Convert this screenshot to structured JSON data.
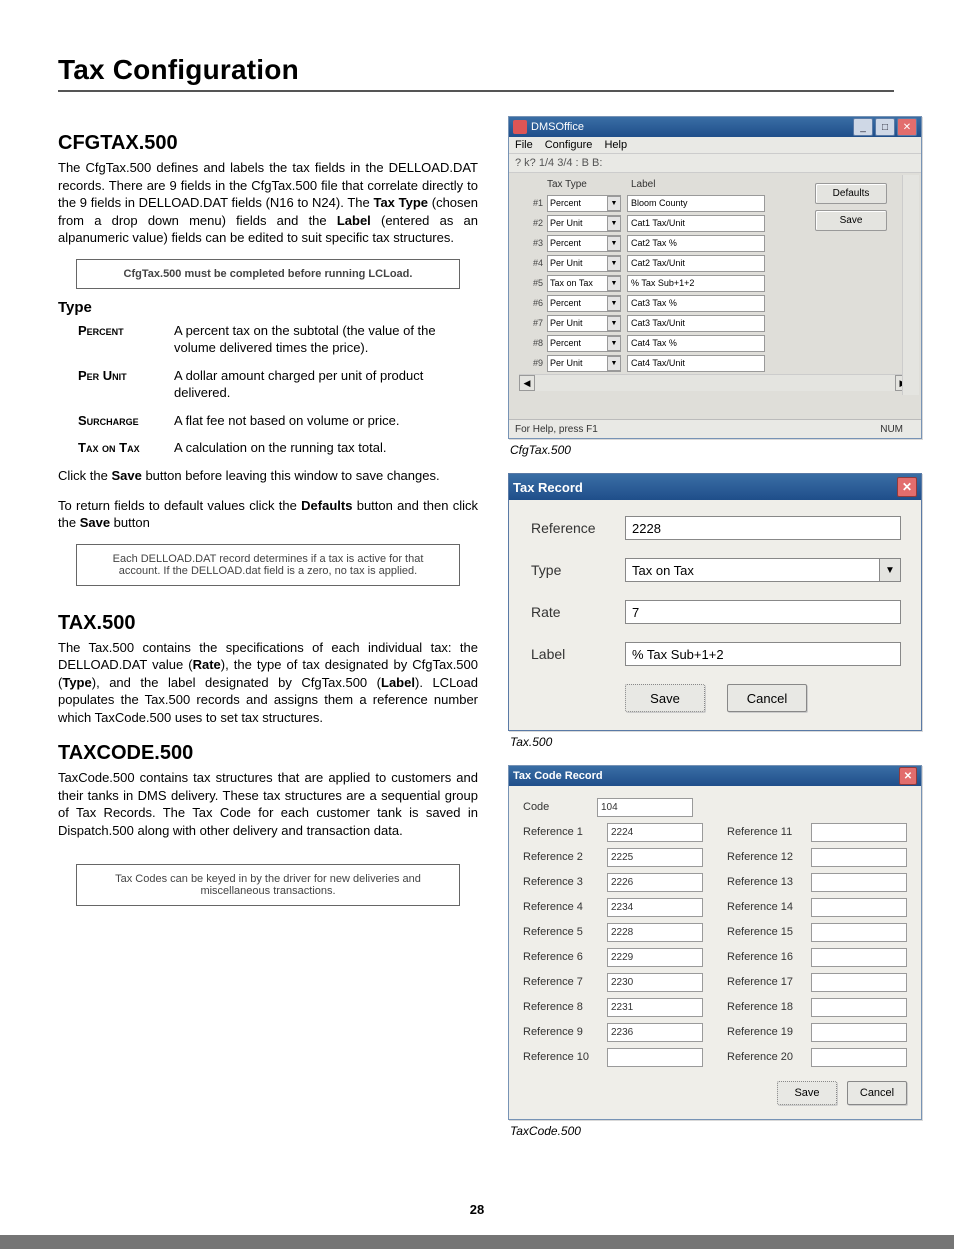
{
  "page_title": "Tax Configuration",
  "page_number": "28",
  "sections": {
    "cfgtax": {
      "title": "CFGTAX.500",
      "p1_a": "The CfgTax.500 defines and labels the tax fields in the DELLOAD​.DAT records. There are 9 fields in the CfgTax.500 file that correlate directly to the 9 fields in DELLOAD​.DAT fields (N16 to N24). The ",
      "p1_b": "Tax Type",
      "p1_c": " (chosen from a drop down menu) fields and the ",
      "p1_d": "Label",
      "p1_e": " (entered as an alpanumeric value) fields can be edited to suit specific tax structures.",
      "note1": "CfgTax.500 must be completed before running LCLoad.",
      "type_head": "Type",
      "defs": [
        {
          "term": "Percent",
          "desc": "A percent tax on the subtotal (the value of the volume delivered times the price)."
        },
        {
          "term": "Per Unit",
          "desc": "A dollar amount charged per unit of product delivered."
        },
        {
          "term": "Surcharge",
          "desc": "A flat fee not based on volume or price."
        },
        {
          "term": "Tax on Tax",
          "desc": "A calculation on the running tax total."
        }
      ],
      "p_save_a": "Click the ",
      "p_save_b": "Save",
      "p_save_c": " button before leaving this window to save changes.",
      "p_def_a": "To return fields to default values click the ",
      "p_def_b": "Defaults",
      "p_def_c": " button and then click the ",
      "p_def_d": "Save",
      "p_def_e": " button",
      "note2": "Each DELLOAD.DAT record determines if a tax is active for that account. If the DELLOAD.dat field is a zero, no tax is applied."
    },
    "tax500": {
      "title": "TAX.500",
      "p_a": "The Tax.500 contains the specifications of each individual tax: the DELLOAD​.DAT value (",
      "p_b": "Rate",
      "p_c": "), the type of tax designated by CfgTax.500 (",
      "p_d": "Type",
      "p_e": "), and the label designated by CfgTax.500 (",
      "p_f": "Label",
      "p_g": "). LCLoad populates the Tax.500 records and assigns them a reference number which TaxCode.500 uses to set tax structures."
    },
    "taxcode": {
      "title": "TAXCODE.500",
      "p": "TaxCode.500 contains tax structures that are applied to customers and their tanks in DMS delivery. These tax structures are a sequential group of Tax Records. The Tax Code for each customer tank is saved in Dispatch.500 along with other delivery and transaction data.",
      "note": "Tax Codes can be keyed in by the driver for new deliveries and miscellaneous transactions."
    }
  },
  "dms_office": {
    "window_title": "DMSOffice",
    "menu": [
      "File",
      "Configure",
      "Help"
    ],
    "toolbar_glyphs": "?  k?  1/4  3/4  :  B  B:",
    "head_tax_type": "Tax Type",
    "head_label": "Label",
    "btn_defaults": "Defaults",
    "btn_save": "Save",
    "rows": [
      {
        "idx": "#1",
        "type": "Percent",
        "label": "Bloom County"
      },
      {
        "idx": "#2",
        "type": "Per Unit",
        "label": "Cat1 Tax/Unit"
      },
      {
        "idx": "#3",
        "type": "Percent",
        "label": "Cat2 Tax %"
      },
      {
        "idx": "#4",
        "type": "Per Unit",
        "label": "Cat2 Tax/Unit"
      },
      {
        "idx": "#5",
        "type": "Tax on Tax",
        "label": "% Tax Sub+1+2"
      },
      {
        "idx": "#6",
        "type": "Percent",
        "label": "Cat3 Tax %"
      },
      {
        "idx": "#7",
        "type": "Per Unit",
        "label": "Cat3 Tax/Unit"
      },
      {
        "idx": "#8",
        "type": "Percent",
        "label": "Cat4 Tax %"
      },
      {
        "idx": "#9",
        "type": "Per Unit",
        "label": "Cat4 Tax/Unit"
      }
    ],
    "status_left": "For Help, press F1",
    "status_right": "NUM",
    "caption": "CfgTax.500"
  },
  "tax_record": {
    "window_title": "Tax Record",
    "fields": {
      "reference_label": "Reference",
      "reference_value": "2228",
      "type_label": "Type",
      "type_value": "Tax on Tax",
      "rate_label": "Rate",
      "rate_value": "7",
      "label_label": "Label",
      "label_value": "% Tax Sub+1+2"
    },
    "btn_save": "Save",
    "btn_cancel": "Cancel",
    "caption": "Tax.500"
  },
  "tax_code_record": {
    "window_title": "Tax Code Record",
    "code_label": "Code",
    "code_value": "104",
    "left": [
      {
        "label": "Reference 1",
        "value": "2224"
      },
      {
        "label": "Reference 2",
        "value": "2225"
      },
      {
        "label": "Reference 3",
        "value": "2226"
      },
      {
        "label": "Reference 4",
        "value": "2234"
      },
      {
        "label": "Reference 5",
        "value": "2228"
      },
      {
        "label": "Reference 6",
        "value": "2229"
      },
      {
        "label": "Reference 7",
        "value": "2230"
      },
      {
        "label": "Reference 8",
        "value": "2231"
      },
      {
        "label": "Reference 9",
        "value": "2236"
      },
      {
        "label": "Reference 10",
        "value": ""
      }
    ],
    "right": [
      {
        "label": "Reference 11",
        "value": ""
      },
      {
        "label": "Reference 12",
        "value": ""
      },
      {
        "label": "Reference 13",
        "value": ""
      },
      {
        "label": "Reference 14",
        "value": ""
      },
      {
        "label": "Reference 15",
        "value": ""
      },
      {
        "label": "Reference 16",
        "value": ""
      },
      {
        "label": "Reference 17",
        "value": ""
      },
      {
        "label": "Reference 18",
        "value": ""
      },
      {
        "label": "Reference 19",
        "value": ""
      },
      {
        "label": "Reference 20",
        "value": ""
      }
    ],
    "btn_save": "Save",
    "btn_cancel": "Cancel",
    "caption": "TaxCode.500"
  }
}
